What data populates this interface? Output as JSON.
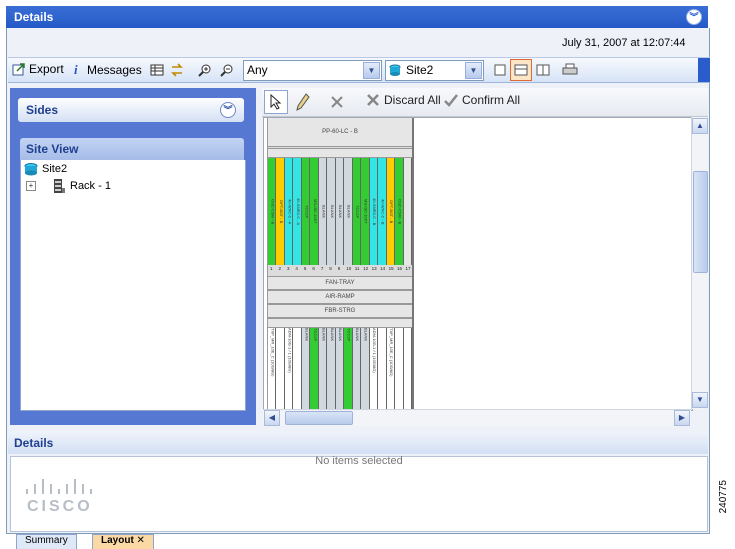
{
  "window": {
    "title": "Details"
  },
  "header": {
    "date": "July 31, 2007 at 12:07:44"
  },
  "toolbar": {
    "export_label": "Export",
    "messages_label": "Messages",
    "filter_value": "Any",
    "site_value": "Site2"
  },
  "sides": {
    "title": "Sides"
  },
  "site_view": {
    "title": "Site View",
    "tree": [
      {
        "label": "Site2"
      },
      {
        "label": "Rack - 1"
      }
    ]
  },
  "view_toolbar": {
    "discard_label": "Discard All",
    "confirm_label": "Confirm All"
  },
  "rack": {
    "top_label": "PP-60-LC - B",
    "slot_numbers": [
      "1",
      "2",
      "3",
      "4",
      "5",
      "6",
      "7",
      "8",
      "9",
      "10",
      "11",
      "12",
      "13",
      "14",
      "15",
      "16",
      "17"
    ],
    "upper_slots": [
      {
        "label": "OSC-CSM - B",
        "color": "#33cc33"
      },
      {
        "label": "OPT-BST - B",
        "color": "#ffcc00"
      },
      {
        "label": "40-WXC-C - A",
        "color": "#33e6e6"
      },
      {
        "label": "40-SMR2-C - A",
        "color": "#33e6e6"
      },
      {
        "label": "TCC2P",
        "color": "#33cc33"
      },
      {
        "label": "MS-ISC-100T",
        "color": "#33cc33"
      },
      {
        "label": "BLANK",
        "color": "#d0d8e0"
      },
      {
        "label": "BLANK",
        "color": "#d0d8e0"
      },
      {
        "label": "BLANK",
        "color": "#d0d8e0"
      },
      {
        "label": "BLANK",
        "color": "#d0d8e0"
      },
      {
        "label": "TCC2P",
        "color": "#33cc33"
      },
      {
        "label": "MS-ISC-100T",
        "color": "#33cc33"
      },
      {
        "label": "40-SMR2-C - B",
        "color": "#33e6e6"
      },
      {
        "label": "40-WXC-C - B",
        "color": "#33e6e6"
      },
      {
        "label": "OPT-BST - B",
        "color": "#ffcc00"
      },
      {
        "label": "OSC-CSM - B",
        "color": "#33cc33"
      },
      {
        "label": "",
        "color": "#e6e6e6"
      }
    ],
    "mid_rows": [
      "FAN-TRAY",
      "AIR-RAMP",
      "FBR-STRG"
    ],
    "lower_slots": [
      {
        "label": "TXP_MR_10E_C (10G/8G)",
        "color": "#ffffff"
      },
      {
        "label": "",
        "color": "#ffffff"
      },
      {
        "label": "ADM-10G-1 / 1 (10G/8G)",
        "color": "#ffffff"
      },
      {
        "label": "",
        "color": "#ffffff"
      },
      {
        "label": "BLANK",
        "color": "#d0d8e0"
      },
      {
        "label": "TCC2P",
        "color": "#33cc33"
      },
      {
        "label": "BLANK",
        "color": "#d0d8e0"
      },
      {
        "label": "BLANK",
        "color": "#d0d8e0"
      },
      {
        "label": "BLANK",
        "color": "#d0d8e0"
      },
      {
        "label": "TCC2P",
        "color": "#33cc33"
      },
      {
        "label": "BLANK",
        "color": "#d0d8e0"
      },
      {
        "label": "BLANK",
        "color": "#d0d8e0"
      },
      {
        "label": "ADM-10G-1 / 1 (10G/8G)",
        "color": "#ffffff"
      },
      {
        "label": "",
        "color": "#ffffff"
      },
      {
        "label": "TXP_MR_10E_C (10G/8G)",
        "color": "#ffffff"
      },
      {
        "label": "",
        "color": "#ffffff"
      },
      {
        "label": "",
        "color": "#ffffff"
      }
    ]
  },
  "details": {
    "title": "Details",
    "empty_text": "No items selected"
  },
  "logo": {
    "text": "CISCO"
  },
  "tabs": [
    {
      "label": "Summary"
    },
    {
      "label": "Layout"
    }
  ],
  "figure_id": "240775"
}
